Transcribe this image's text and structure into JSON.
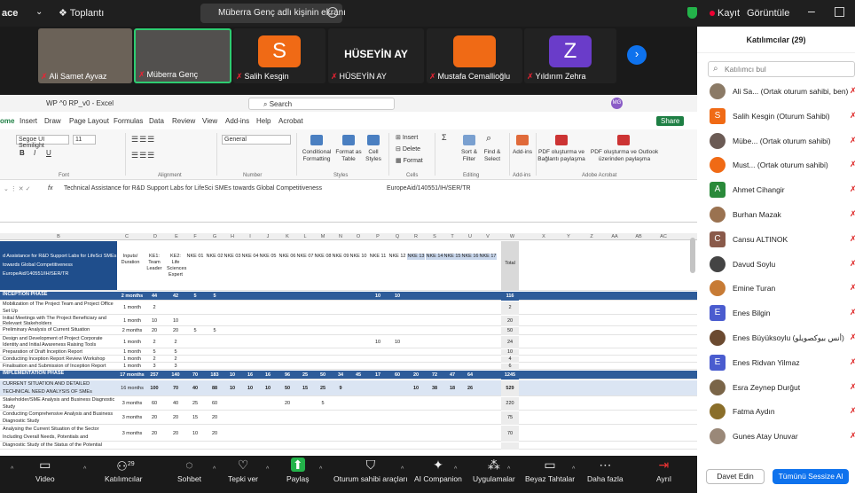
{
  "topbar": {
    "app": "ace",
    "view_label": "Toplantı",
    "banner": "Müberra Genç adlı kişinin ekranı",
    "record_label": "Kayıt",
    "view_mode_label": "Görüntüle"
  },
  "video_strip": {
    "tiles": [
      {
        "name": "Ali Samet Ayvaz",
        "type": "video",
        "color": "#6b6258"
      },
      {
        "name": "Müberra Genç",
        "type": "video",
        "color": "#52504e",
        "active": true
      },
      {
        "name": "Salih Kesgin",
        "type": "avatar",
        "initial": "S",
        "color": "#f06a15"
      },
      {
        "name": "HÜSEYİN AY",
        "type": "text",
        "title": "HÜSEYİN AY"
      },
      {
        "name": "Mustafa Cemallioğlu",
        "type": "avatar",
        "initial": "",
        "color": "#f06a15"
      },
      {
        "name": "Yıldırım Zehra",
        "type": "avatar",
        "initial": "Z",
        "color": "#6a3cc9"
      }
    ]
  },
  "excel": {
    "title": "WP ^0 RP_v0 - Excel",
    "search_placeholder": "Search",
    "avatar_initials": "MG",
    "menus": [
      "ome",
      "Insert",
      "Draw",
      "Page Layout",
      "Formulas",
      "Data",
      "Review",
      "View",
      "Add-ins",
      "Help",
      "Acrobat"
    ],
    "share_label": "Share",
    "ribbon": {
      "font_name": "Segoe UI Semilight",
      "font_size": "11",
      "number_format": "General",
      "groups": [
        "Font",
        "Alignment",
        "Number",
        "Styles",
        "Cells",
        "Editing",
        "Add-ins",
        "Adobe Acrobat"
      ],
      "buttons": {
        "conditional": "Conditional Formatting",
        "format_table": "Format as Table",
        "cell_styles": "Cell Styles",
        "insert": "Insert",
        "delete": "Delete",
        "format": "Format",
        "sort": "Sort & Filter",
        "find": "Find & Select",
        "addins": "Add-ins",
        "pdf1": "PDF oluşturma ve Bağlantı paylaşma",
        "pdf2": "PDF oluşturma ve Outlook üzerinden paylaşma"
      }
    },
    "formula": {
      "fx": "fx",
      "text": "Technical Assistance for R&D Support Labs for LifeSci SMEs towards Global Competitiveness",
      "code": "EuropeAid/140551/IH/SER/TR"
    },
    "columns": [
      "B",
      "C",
      "D",
      "E",
      "F",
      "G",
      "H",
      "I",
      "J",
      "K",
      "L",
      "M",
      "N",
      "O",
      "P",
      "Q",
      "R",
      "S",
      "T",
      "U",
      "V",
      "W",
      "X",
      "Y",
      "Z",
      "AA",
      "AB",
      "AC"
    ],
    "header_row": {
      "a": "d Assistance for R&D Support Labs for LifeSci SMEs towards Global Competitiveness EuropeAid/140551/IH/SER/TR",
      "cells": [
        "Inputs/ Duration",
        "KE1: Team Leader",
        "KE2: Life Sciences Expert",
        "NKE 01",
        "NKE 02",
        "NKE 03",
        "NKE 04",
        "NKE 05",
        "NKE 06",
        "NKE 07",
        "NKE 08",
        "NKE 09",
        "NKE 10",
        "NKE 11",
        "NKE 12",
        "NKE 13",
        "NKE 14",
        "NKE 15",
        "NKE 16",
        "NKE 17",
        "Total"
      ]
    },
    "rows": [
      {
        "a": "INCEPTION PHASE",
        "style": "ph",
        "c": "2 months",
        "vals": [
          "44",
          "42",
          "5",
          "5",
          "",
          "",
          "",
          "",
          "",
          "",
          "",
          "",
          "10",
          "10",
          "",
          "",
          "",
          "",
          "",
          "116"
        ]
      },
      {
        "a": "Mobilization of The Project Team and Project Office Set Up",
        "style": "",
        "c": "1 month",
        "vals": [
          "2",
          "",
          "",
          "",
          "",
          "",
          "",
          "",
          "",
          "",
          "",
          "",
          "",
          "",
          "",
          "",
          "",
          "",
          "",
          "2"
        ]
      },
      {
        "a": "Initial Meetings with The Project Beneficiary and Relevant Stakeholders",
        "style": "",
        "c": "1 month",
        "vals": [
          "10",
          "10",
          "",
          "",
          "",
          "",
          "",
          "",
          "",
          "",
          "",
          "",
          "",
          "",
          "",
          "",
          "",
          "",
          "",
          "20"
        ]
      },
      {
        "a": "Preliminary Analysis of Current Situation",
        "style": "",
        "c": "2 months",
        "vals": [
          "20",
          "20",
          "5",
          "5",
          "",
          "",
          "",
          "",
          "",
          "",
          "",
          "",
          "",
          "",
          "",
          "",
          "",
          "",
          "",
          "50"
        ]
      },
      {
        "a": "Design and Development of Project Corporate Identity and Initial Awareness Raising Tools",
        "style": "",
        "c": "1 month",
        "vals": [
          "2",
          "2",
          "",
          "",
          "",
          "",
          "",
          "",
          "",
          "",
          "",
          "",
          "10",
          "10",
          "",
          "",
          "",
          "",
          "",
          "24"
        ]
      },
      {
        "a": "Preparation of Draft Inception Report",
        "style": "",
        "c": "1 month",
        "vals": [
          "5",
          "5",
          "",
          "",
          "",
          "",
          "",
          "",
          "",
          "",
          "",
          "",
          "",
          "",
          "",
          "",
          "",
          "",
          "",
          "10"
        ]
      },
      {
        "a": "Conducting Inception Report Review Workshop",
        "style": "",
        "c": "1 month",
        "vals": [
          "2",
          "2",
          "",
          "",
          "",
          "",
          "",
          "",
          "",
          "",
          "",
          "",
          "",
          "",
          "",
          "",
          "",
          "",
          "",
          "4"
        ]
      },
      {
        "a": "Finalisation and Submission of Inception Report",
        "style": "",
        "c": "1 month",
        "vals": [
          "3",
          "3",
          "",
          "",
          "",
          "",
          "",
          "",
          "",
          "",
          "",
          "",
          "",
          "",
          "",
          "",
          "",
          "",
          "",
          "6"
        ]
      },
      {
        "a": "IMPLEMENTATION PHASE",
        "style": "ph",
        "c": "17 months",
        "vals": [
          "257",
          "140",
          "70",
          "183",
          "10",
          "16",
          "16",
          "96",
          "25",
          "50",
          "34",
          "45",
          "17",
          "60",
          "20",
          "72",
          "47",
          "64",
          "",
          "1245"
        ]
      },
      {
        "a": "CURRENT SITUATION AND DETAILED TECHNICAL NEED ANALYSIS OF SMEs",
        "style": "sub",
        "c": "16 months",
        "vals": [
          "100",
          "70",
          "40",
          "88",
          "10",
          "10",
          "10",
          "50",
          "15",
          "25",
          "9",
          "",
          "",
          "",
          "10",
          "38",
          "18",
          "26",
          "",
          "529"
        ]
      },
      {
        "a": "Stakeholder/SME Analysis and Business Diagnostic Study",
        "style": "",
        "c": "3 months",
        "vals": [
          "60",
          "40",
          "25",
          "60",
          "",
          "",
          "",
          "20",
          "",
          "5",
          "",
          "",
          "",
          "",
          "",
          "",
          "",
          "",
          "",
          "220"
        ]
      },
      {
        "a": "Conducting Comprehensive Analysis and Business Diagnostic Study",
        "style": "",
        "c": "3 months",
        "vals": [
          "20",
          "20",
          "15",
          "20",
          "",
          "",
          "",
          "",
          "",
          "",
          "",
          "",
          "",
          "",
          "",
          "",
          "",
          "",
          "",
          "75"
        ]
      },
      {
        "a": "Analysing the Current Situation of the Sector Including Overall Needs, Potentials and Shortcomings",
        "style": "",
        "c": "3 months",
        "vals": [
          "20",
          "20",
          "10",
          "20",
          "",
          "",
          "",
          "",
          "",
          "",
          "",
          "",
          "",
          "",
          "",
          "",
          "",
          "",
          "",
          "70"
        ]
      },
      {
        "a": "Diagnostic Study of the Status of the Potential",
        "style": "",
        "c": "",
        "vals": [
          "",
          "",
          "",
          "",
          "",
          "",
          "",
          "",
          "",
          "",
          "",
          "",
          "",
          "",
          "",
          "",
          "",
          "",
          "",
          ""
        ]
      }
    ]
  },
  "panel": {
    "title": "Katılımcılar (29)",
    "search_placeholder": "Katılımcı bul",
    "participants": [
      {
        "name": "Ali Sa... (Ortak oturum sahibi, ben)",
        "initial": "",
        "color": "#8b7a66"
      },
      {
        "name": "Salih Kesgin (Oturum Sahibi)",
        "initial": "S",
        "color": "#f06a15"
      },
      {
        "name": "Mübe... (Ortak oturum sahibi)",
        "initial": "",
        "color": "#6b5b55"
      },
      {
        "name": "Must... (Ortak oturum sahibi)",
        "initial": "",
        "color": "#f06a15"
      },
      {
        "name": "Ahmet Cihangir",
        "initial": "A",
        "color": "#2a8a3a"
      },
      {
        "name": "Burhan Mazak",
        "initial": "",
        "color": "#9a7250"
      },
      {
        "name": "Cansu ALTINOK",
        "initial": "C",
        "color": "#8a5a4a"
      },
      {
        "name": "Davud Soylu",
        "initial": "",
        "color": "#444"
      },
      {
        "name": "Emine Turan",
        "initial": "",
        "color": "#c77b35"
      },
      {
        "name": "Enes Bilgin",
        "initial": "E",
        "color": "#4a5ccf"
      },
      {
        "name": "Enes Büyüksoylu (أنس بيوكصويلو)",
        "initial": "",
        "color": "#6b4a30"
      },
      {
        "name": "Enes Ridvan Yilmaz",
        "initial": "E",
        "color": "#4a5ccf"
      },
      {
        "name": "Esra Zeynep Durğut",
        "initial": "",
        "color": "#7a6548"
      },
      {
        "name": "Fatma Aydın",
        "initial": "",
        "color": "#8a6e2a"
      },
      {
        "name": "Gunes Atay Unuvar",
        "initial": "",
        "color": "#9a8878"
      }
    ],
    "invite_label": "Davet Edin",
    "mute_all_label": "Tümünü Sessize Al"
  },
  "toolbar": {
    "items": [
      {
        "label": "Video",
        "icon": "video-icon"
      },
      {
        "label": "Katılımcılar",
        "icon": "participants-icon",
        "count": "29"
      },
      {
        "label": "Sohbet",
        "icon": "chat-icon"
      },
      {
        "label": "Tepki ver",
        "icon": "reaction-icon"
      },
      {
        "label": "Paylaş",
        "icon": "share-icon"
      },
      {
        "label": "Oturum sahibi araçları",
        "icon": "host-tools-icon"
      },
      {
        "label": "AI Companion",
        "icon": "ai-icon"
      },
      {
        "label": "Uygulamalar",
        "icon": "apps-icon"
      },
      {
        "label": "Beyaz Tahtalar",
        "icon": "whiteboard-icon"
      },
      {
        "label": "Daha fazla",
        "icon": "more-icon"
      },
      {
        "label": "Ayrıl",
        "icon": "leave-icon"
      }
    ]
  }
}
